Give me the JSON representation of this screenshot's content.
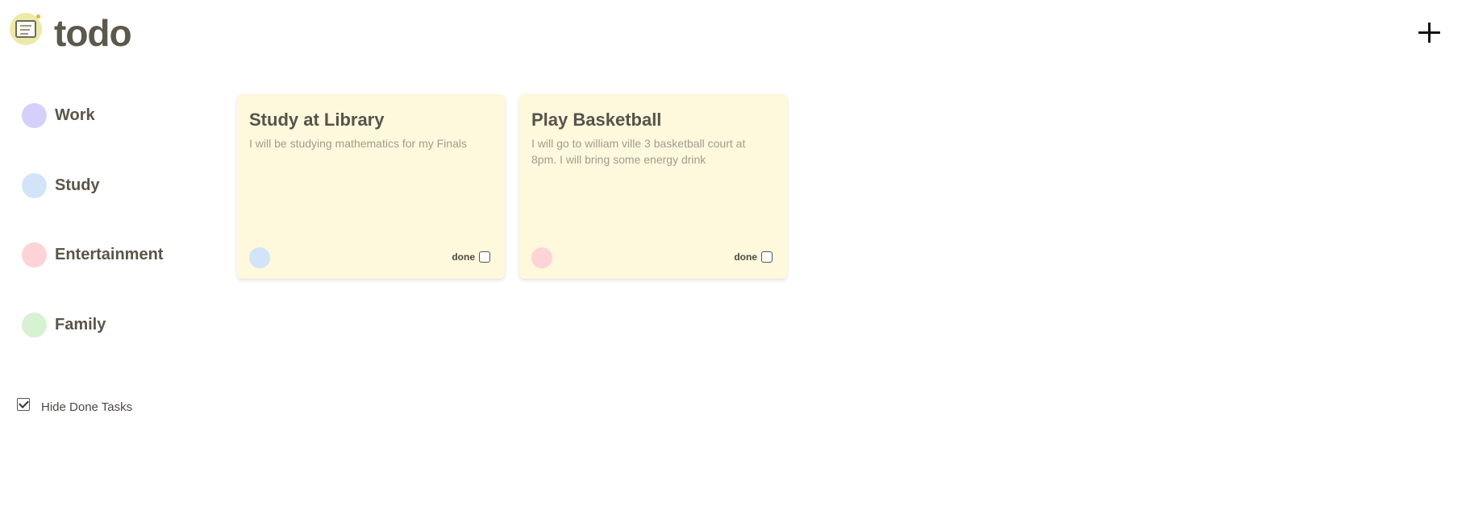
{
  "header": {
    "title": "todo",
    "logo_icon": "notepad-icon",
    "add_icon": "plus-icon"
  },
  "sidebar": {
    "categories": [
      {
        "label": "Work",
        "color": "#d4d0fb"
      },
      {
        "label": "Study",
        "color": "#d2e4f7"
      },
      {
        "label": "Entertainment",
        "color": "#fdd3d8"
      },
      {
        "label": "Family",
        "color": "#d6f2d2"
      }
    ],
    "hide_done": {
      "label": "Hide Done Tasks",
      "checked": true
    }
  },
  "cards": [
    {
      "title": "Study at Library",
      "description": "I will be studying mathematics for my Finals",
      "category_color": "#d2e4f7",
      "done_label": "done",
      "done": false
    },
    {
      "title": "Play Basketball",
      "description": "I will go to william ville 3 basketball court at 8pm. I will bring some energy drink",
      "category_color": "#fdd3d8",
      "done_label": "done",
      "done": false
    }
  ],
  "colors": {
    "card_background": "#fef8dc",
    "text_primary": "#5a5548",
    "text_muted": "#a19d8f"
  }
}
